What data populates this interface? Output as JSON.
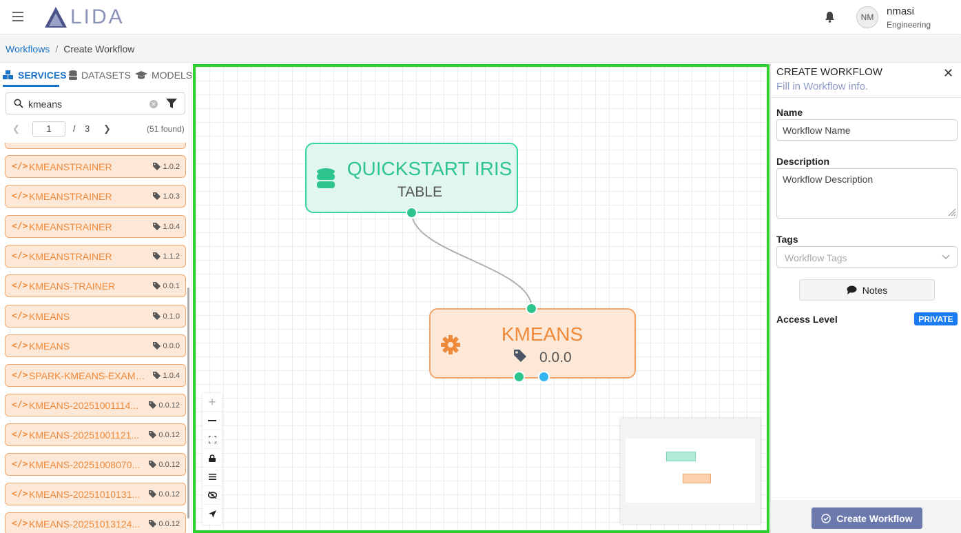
{
  "header": {
    "logo_text": "LIDA",
    "user": {
      "initials": "NM",
      "name": "nmasi",
      "org": "Engineering"
    }
  },
  "breadcrumb": {
    "parent": "Workflows",
    "separator": "/",
    "current": "Create Workflow"
  },
  "left": {
    "tabs": [
      {
        "label": "SERVICES",
        "icon": "cubes-icon",
        "active": true
      },
      {
        "label": "DATASETS",
        "icon": "database-icon",
        "active": false
      },
      {
        "label": "MODELS",
        "icon": "graduation-cap-icon",
        "active": false
      }
    ],
    "search": {
      "value": "kmeans",
      "placeholder": "Search"
    },
    "pager": {
      "page": "1",
      "separator": "/",
      "total": "3",
      "found": "(51 found)"
    },
    "services": [
      {
        "name": "KMEANSTRAINER",
        "version": "1.0.2"
      },
      {
        "name": "KMEANSTRAINER",
        "version": "1.0.3"
      },
      {
        "name": "KMEANSTRAINER",
        "version": "1.0.4"
      },
      {
        "name": "KMEANSTRAINER",
        "version": "1.1.2"
      },
      {
        "name": "KMEANS-TRAINER",
        "version": "0.0.1"
      },
      {
        "name": "KMEANS",
        "version": "0.1.0"
      },
      {
        "name": "KMEANS",
        "version": "0.0.0"
      },
      {
        "name": "SPARK-KMEANS-EXAMP...",
        "version": "1.0.4"
      },
      {
        "name": "KMEANS-20251001114...",
        "version": "0.0.12"
      },
      {
        "name": "KMEANS-20251001121...",
        "version": "0.0.12"
      },
      {
        "name": "KMEANS-20251008070...",
        "version": "0.0.12"
      },
      {
        "name": "KMEANS-20251010131...",
        "version": "0.0.12"
      },
      {
        "name": "KMEANS-20251013124...",
        "version": "0.0.12"
      }
    ]
  },
  "canvas": {
    "node_dataset": {
      "title": "QUICKSTART IRIS",
      "subtitle": "TABLE"
    },
    "node_service": {
      "title": "KMEANS",
      "version": "0.0.0"
    },
    "controls": [
      "zoom-in",
      "zoom-out",
      "fit-view",
      "lock",
      "menu",
      "hide",
      "locate"
    ]
  },
  "right": {
    "title": "CREATE WORKFLOW",
    "subtitle": "Fill in Workflow info.",
    "name_label": "Name",
    "name_placeholder": "Workflow Name",
    "desc_label": "Description",
    "desc_placeholder": "Workflow Description",
    "tags_label": "Tags",
    "tags_placeholder": "Workflow Tags",
    "notes_label": "Notes",
    "access_label": "Access Level",
    "access_value": "PRIVATE",
    "create_label": "Create Workflow"
  },
  "colors": {
    "accent": "#1a73c8",
    "canvas_border": "#2fd12f",
    "dataset_node": "#33d6a0",
    "service_node": "#f4a56a",
    "create_button": "#6b79ad"
  }
}
